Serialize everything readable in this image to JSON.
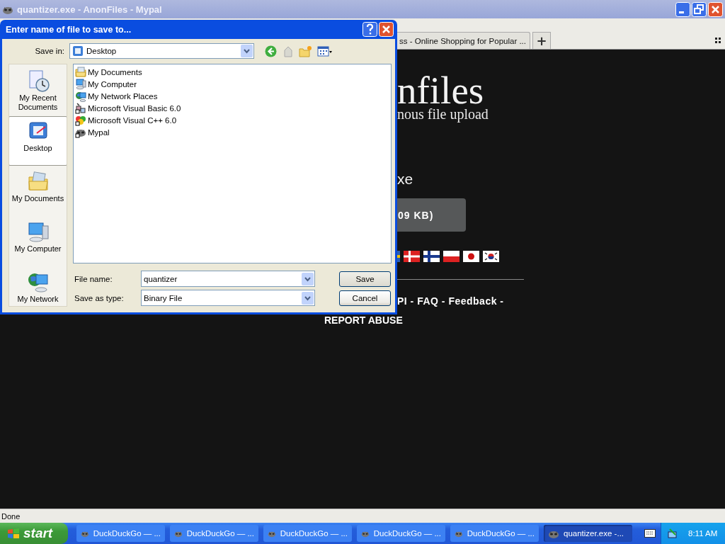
{
  "browser": {
    "title": "quantizer.exe - AnonFiles - Mypal",
    "tabs": [
      {
        "label": "ss - Online Shopping for Popular ...",
        "selected": false
      }
    ],
    "new_tab": "+"
  },
  "page": {
    "logo": "nfiles",
    "tagline": "nous file upload",
    "file_name": "xe",
    "download_button": "09 KB)",
    "footer_links": "PI - FAQ - Feedback -",
    "report_abuse": "REPORT ABUSE"
  },
  "dialog": {
    "title": "Enter name of file to save to...",
    "save_in_label": "Save in:",
    "save_in_value": "Desktop",
    "places": [
      {
        "label": "My Recent Documents",
        "kind": "recent",
        "selected": false
      },
      {
        "label": "Desktop",
        "kind": "desktop",
        "selected": true
      },
      {
        "label": "My Documents",
        "kind": "documents",
        "selected": false
      },
      {
        "label": "My Computer",
        "kind": "computer",
        "selected": false
      },
      {
        "label": "My Network",
        "kind": "network",
        "selected": false
      }
    ],
    "files": [
      {
        "name": "My Documents",
        "kind": "documents"
      },
      {
        "name": "My Computer",
        "kind": "computer"
      },
      {
        "name": "My Network Places",
        "kind": "network"
      },
      {
        "name": "Microsoft Visual Basic 6.0",
        "kind": "vb"
      },
      {
        "name": "Microsoft Visual C++ 6.0",
        "kind": "vc"
      },
      {
        "name": "Mypal",
        "kind": "app"
      }
    ],
    "file_name_label": "File name:",
    "file_name_value": "quantizer",
    "type_label": "Save as type:",
    "type_value": "Binary File",
    "buttons": [
      "Save",
      "Cancel"
    ]
  },
  "status_bar": "Done",
  "taskbar": {
    "start": "start",
    "tasks": [
      {
        "label": "DuckDuckGo — ...",
        "selected": false
      },
      {
        "label": "DuckDuckGo — ...",
        "selected": false
      },
      {
        "label": "DuckDuckGo — ...",
        "selected": false
      },
      {
        "label": "DuckDuckGo — ...",
        "selected": false
      },
      {
        "label": "DuckDuckGo — ...",
        "selected": false
      },
      {
        "label": "quantizer.exe -...",
        "selected": true
      }
    ],
    "clock": "8:11 AM"
  }
}
